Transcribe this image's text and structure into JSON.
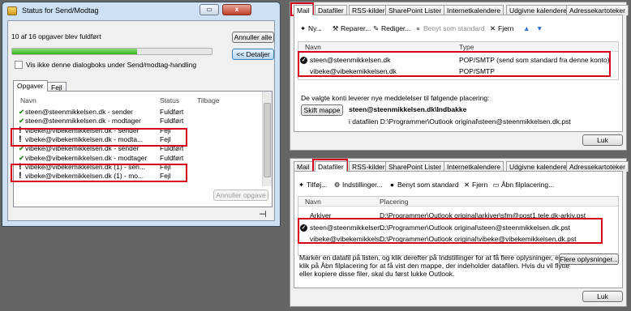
{
  "left_dialog": {
    "title": "Status for Send/Modtag",
    "progress_text": "10 af 16 opgaver blev fuldført",
    "progress_fraction": 0.625,
    "cancel_all_label": "Annuller alle",
    "details_label": "<< Detaljer",
    "checkbox_label": "Vis ikke denne dialogboks under Send/modtag-handling",
    "tabs": [
      "Opgaver",
      "Fejl"
    ],
    "columns": [
      "Navn",
      "Status",
      "Tilbage"
    ],
    "rows": [
      {
        "icon": "check",
        "name": "steen@steenmikkelsen.dk - sender",
        "status": "Fuldført"
      },
      {
        "icon": "check",
        "name": "steen@steenmikkelsen.dk - modtager",
        "status": "Fuldført"
      },
      {
        "icon": "error",
        "name": "vibeke@vibekemikkelsen.dk - sender",
        "status": "Fejl"
      },
      {
        "icon": "error",
        "name": "vibeke@vibekemikkelsen.dk - modta...",
        "status": "Fejl"
      },
      {
        "icon": "check",
        "name": "vibeke@vibekemikkelsen.dk - sender",
        "status": "Fuldført"
      },
      {
        "icon": "check",
        "name": "vibeke@vibekemikkelsen.dk - modtager",
        "status": "Fuldført"
      },
      {
        "icon": "error",
        "name": "vibeke@vibekemikkelsen.dk (1) - sen...",
        "status": "Fejl"
      },
      {
        "icon": "error",
        "name": "vibeke@vibekemikkelsen.dk (1) - mo...",
        "status": "Fejl"
      }
    ],
    "cancel_task_label": "Annuller opgave",
    "pin_icon": "pin-icon"
  },
  "top_pane": {
    "tabs": [
      "Mail",
      "Datafiler",
      "RSS-kilder",
      "SharePoint Lister",
      "Internetkalendere",
      "Udgivne kalendere",
      "Adressekartoteker"
    ],
    "toolbar": {
      "new": "Ny...",
      "repair": "Reparer...",
      "edit": "Rediger...",
      "set_default": "Benyt som standard",
      "remove": "Fjern"
    },
    "columns": [
      "Navn",
      "Type"
    ],
    "accounts": [
      {
        "name": "steen@steenmikkelsen.dk",
        "type": "POP/SMTP (send som standard fra denne konto)",
        "default": true
      },
      {
        "name": "vibeke@vibekemikkelsen.dk",
        "type": "POP/SMTP",
        "default": false
      }
    ],
    "delivery_text": "De valgte konti leverer nye meddelelser til følgende placering:",
    "change_folder_label": "Skift mappe",
    "folder_path": "steen@steenmikkelsen.dk\\Indbakke",
    "datafile_text": "i datafilen D:\\Programmer\\Outlook original\\steen@steenmikkelsen.dk.pst",
    "close_label": "Luk"
  },
  "bottom_pane": {
    "tabs": [
      "Mail",
      "Datafiler",
      "RSS-kilder",
      "SharePoint Lister",
      "Internetkalendere",
      "Udgivne kalendere",
      "Adressekartoteker"
    ],
    "toolbar": {
      "add": "Tilføj...",
      "settings": "Indstillinger...",
      "set_default": "Benyt som standard",
      "remove": "Fjern",
      "open_location": "Åbn filplacering..."
    },
    "columns": [
      "Navn",
      "Placering"
    ],
    "files": [
      {
        "name": "Arkiver",
        "location": "D:\\Programmer\\Outlook original\\arkiver\\sfm@post1.tele.dk-arkiv.pst",
        "default": false
      },
      {
        "name": "steen@steenmikkelsen...",
        "location": "D:\\Programmer\\Outlook original\\steen@steenmikkelsen.dk.pst",
        "default": true
      },
      {
        "name": "vibeke@vibekemikkels...",
        "location": "D:\\Programmer\\Outlook original\\vibeke@vibekemikkelsen.dk.pst",
        "default": false
      }
    ],
    "info_lines": [
      "Markér en datafil på listen, og klik derefter på Indstillinger for at få flere oplysninger, eller",
      "klik på Åbn filplacering for at få vist den mappe, der indeholder datafilen. Hvis du vil flytte",
      "eller kopiere disse filer, skal du først lukke Outlook."
    ],
    "more_info_label": "Flere oplysninger...",
    "close_label": "Luk"
  },
  "colors": {
    "highlight": "#d9001b",
    "success": "#2a8a23",
    "progress": "#37b21c"
  }
}
